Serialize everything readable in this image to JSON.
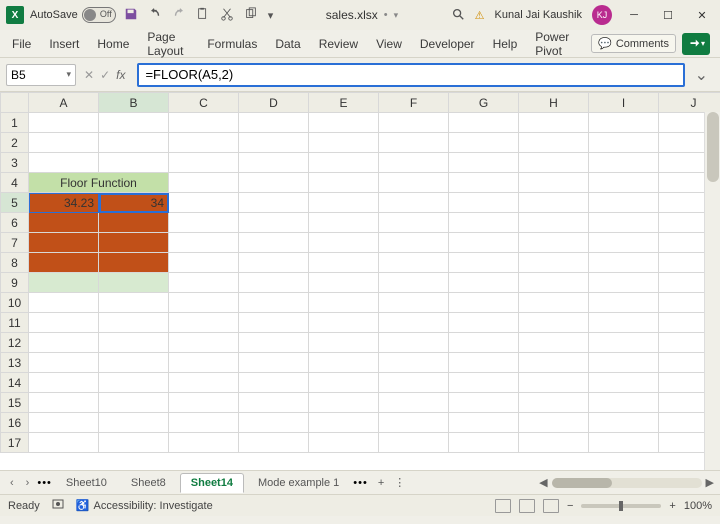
{
  "titlebar": {
    "autosave_label": "AutoSave",
    "autosave_state": "Off",
    "filename": "sales.xlsx",
    "saved_indicator": "•",
    "user_name": "Kunal Jai Kaushik",
    "user_initials": "KJ"
  },
  "ribbon": {
    "tabs": [
      "File",
      "Insert",
      "Home",
      "Page Layout",
      "Formulas",
      "Data",
      "Review",
      "View",
      "Developer",
      "Help",
      "Power Pivot"
    ],
    "comments_label": "Comments"
  },
  "formula_bar": {
    "name_box": "B5",
    "formula": "=FLOOR(A5,2)"
  },
  "columns": [
    "A",
    "B",
    "C",
    "D",
    "E",
    "F",
    "G",
    "H",
    "I",
    "J"
  ],
  "rows": [
    "1",
    "2",
    "3",
    "4",
    "5",
    "6",
    "7",
    "8",
    "9",
    "10",
    "11",
    "12",
    "13",
    "14",
    "15",
    "16",
    "17"
  ],
  "cells": {
    "merged_header": "Floor Function",
    "A5": "34.23",
    "B5": "34"
  },
  "sheet_tabs": {
    "dots": "•••",
    "tabs": [
      "Sheet10",
      "Sheet8",
      "Sheet14",
      "Mode example 1"
    ],
    "active": "Sheet14",
    "more": "•••"
  },
  "statusbar": {
    "mode": "Ready",
    "accessibility": "Accessibility: Investigate",
    "zoom": "100%"
  }
}
